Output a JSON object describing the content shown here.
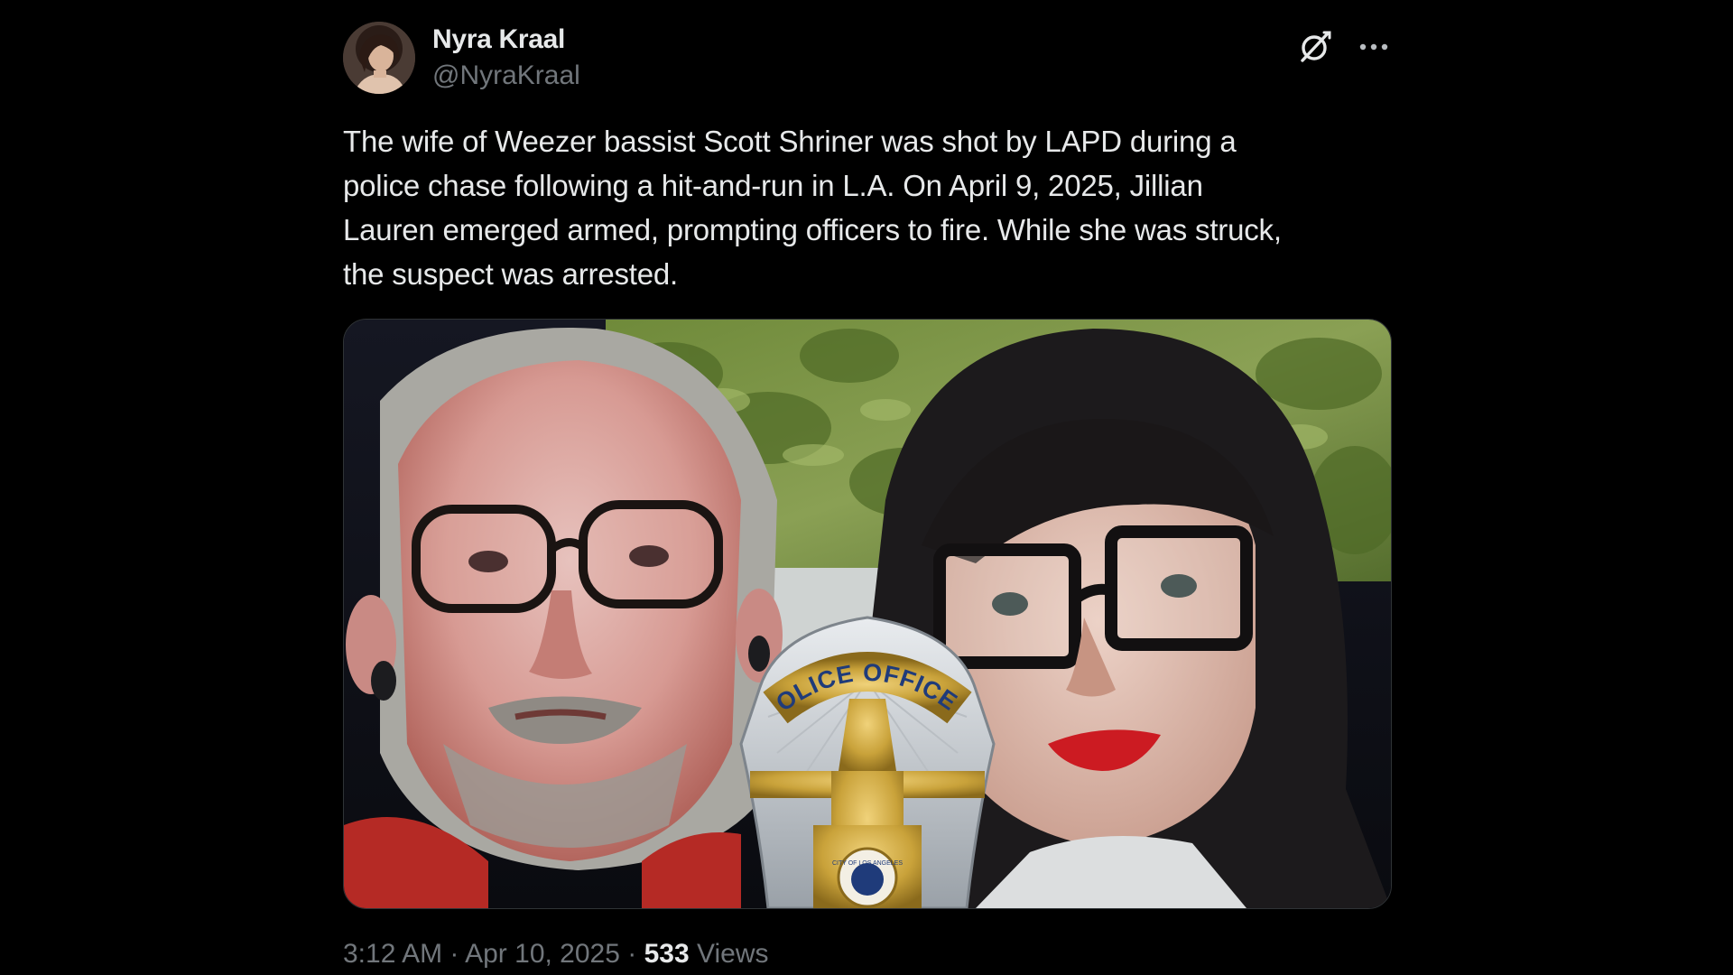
{
  "author": {
    "name": "Nyra Kraal",
    "handle": "@NyraKraal",
    "avatar_icon": "avatar"
  },
  "actions": {
    "grok_icon": "grok-icon",
    "more_icon": "more-icon"
  },
  "post": {
    "text": "The wife of Weezer bassist Scott Shriner was shot by LAPD during a\npolice chase following a hit-and-run in L.A. On April 9, 2025, Jillian\nLauren emerged armed, prompting officers to fire. While she was struck,\nthe suspect was arrested."
  },
  "media": {
    "badge_text": "POLICE OFFICER",
    "seal_text": "CITY OF LOS ANGELES"
  },
  "meta": {
    "time": "3:12 AM",
    "separator": "·",
    "date": "Apr 10, 2025",
    "views_count": "533",
    "views_label": "Views"
  },
  "colors": {
    "background": "#000000",
    "text_primary": "#e7e9ea",
    "text_secondary": "#71767b",
    "badge_gold": "#c9a23a"
  }
}
